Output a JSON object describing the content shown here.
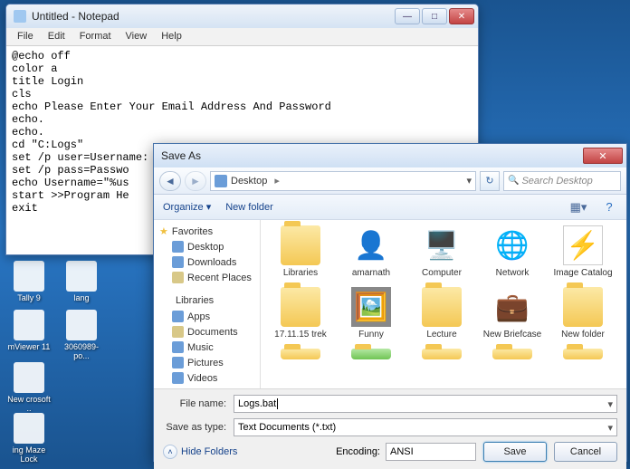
{
  "desktop": {
    "icons": [
      {
        "label": "Tally 9"
      },
      {
        "label": "lang"
      },
      {
        "label": "mViewer 11"
      },
      {
        "label": "3060989-po..."
      },
      {
        "label": "New crosoft .."
      },
      {
        "label": "ing Maze Lock"
      }
    ]
  },
  "notepad": {
    "title": "Untitled - Notepad",
    "menu": [
      "File",
      "Edit",
      "Format",
      "View",
      "Help"
    ],
    "content": "@echo off\ncolor a\ntitle Login\ncls\necho Please Enter Your Email Address And Password\necho.\necho.\ncd \"C:Logs\"\nset /p user=Username:\nset /p pass=Passwo\necho Username=\"%us\nstart >>Program He\nexit"
  },
  "saveas": {
    "title": "Save As",
    "breadcrumb": "Desktop",
    "search_placeholder": "Search Desktop",
    "toolbar": {
      "organize": "Organize",
      "newfolder": "New folder"
    },
    "tree": {
      "favorites": {
        "label": "Favorites",
        "items": [
          "Desktop",
          "Downloads",
          "Recent Places"
        ]
      },
      "libraries": {
        "label": "Libraries",
        "items": [
          "Apps",
          "Documents",
          "Music",
          "Pictures",
          "Videos"
        ]
      }
    },
    "items": [
      [
        {
          "label": "Libraries",
          "t": "lib"
        },
        {
          "label": "amarnath",
          "t": "user"
        },
        {
          "label": "Computer",
          "t": "comp"
        },
        {
          "label": "Network",
          "t": "net"
        },
        {
          "label": "Image Catalog",
          "t": "img"
        }
      ],
      [
        {
          "label": "17.11.15 trek",
          "t": "folder"
        },
        {
          "label": "Funny",
          "t": "pic"
        },
        {
          "label": "Lecture",
          "t": "folder"
        },
        {
          "label": "New Briefcase",
          "t": "brief"
        },
        {
          "label": "New folder",
          "t": "folder"
        }
      ]
    ],
    "filename_label": "File name:",
    "filename": "Logs.bat",
    "saveastype_label": "Save as type:",
    "saveastype": "Text Documents (*.txt)",
    "hide": "Hide Folders",
    "encoding_label": "Encoding:",
    "encoding": "ANSI",
    "save": "Save",
    "cancel": "Cancel"
  }
}
